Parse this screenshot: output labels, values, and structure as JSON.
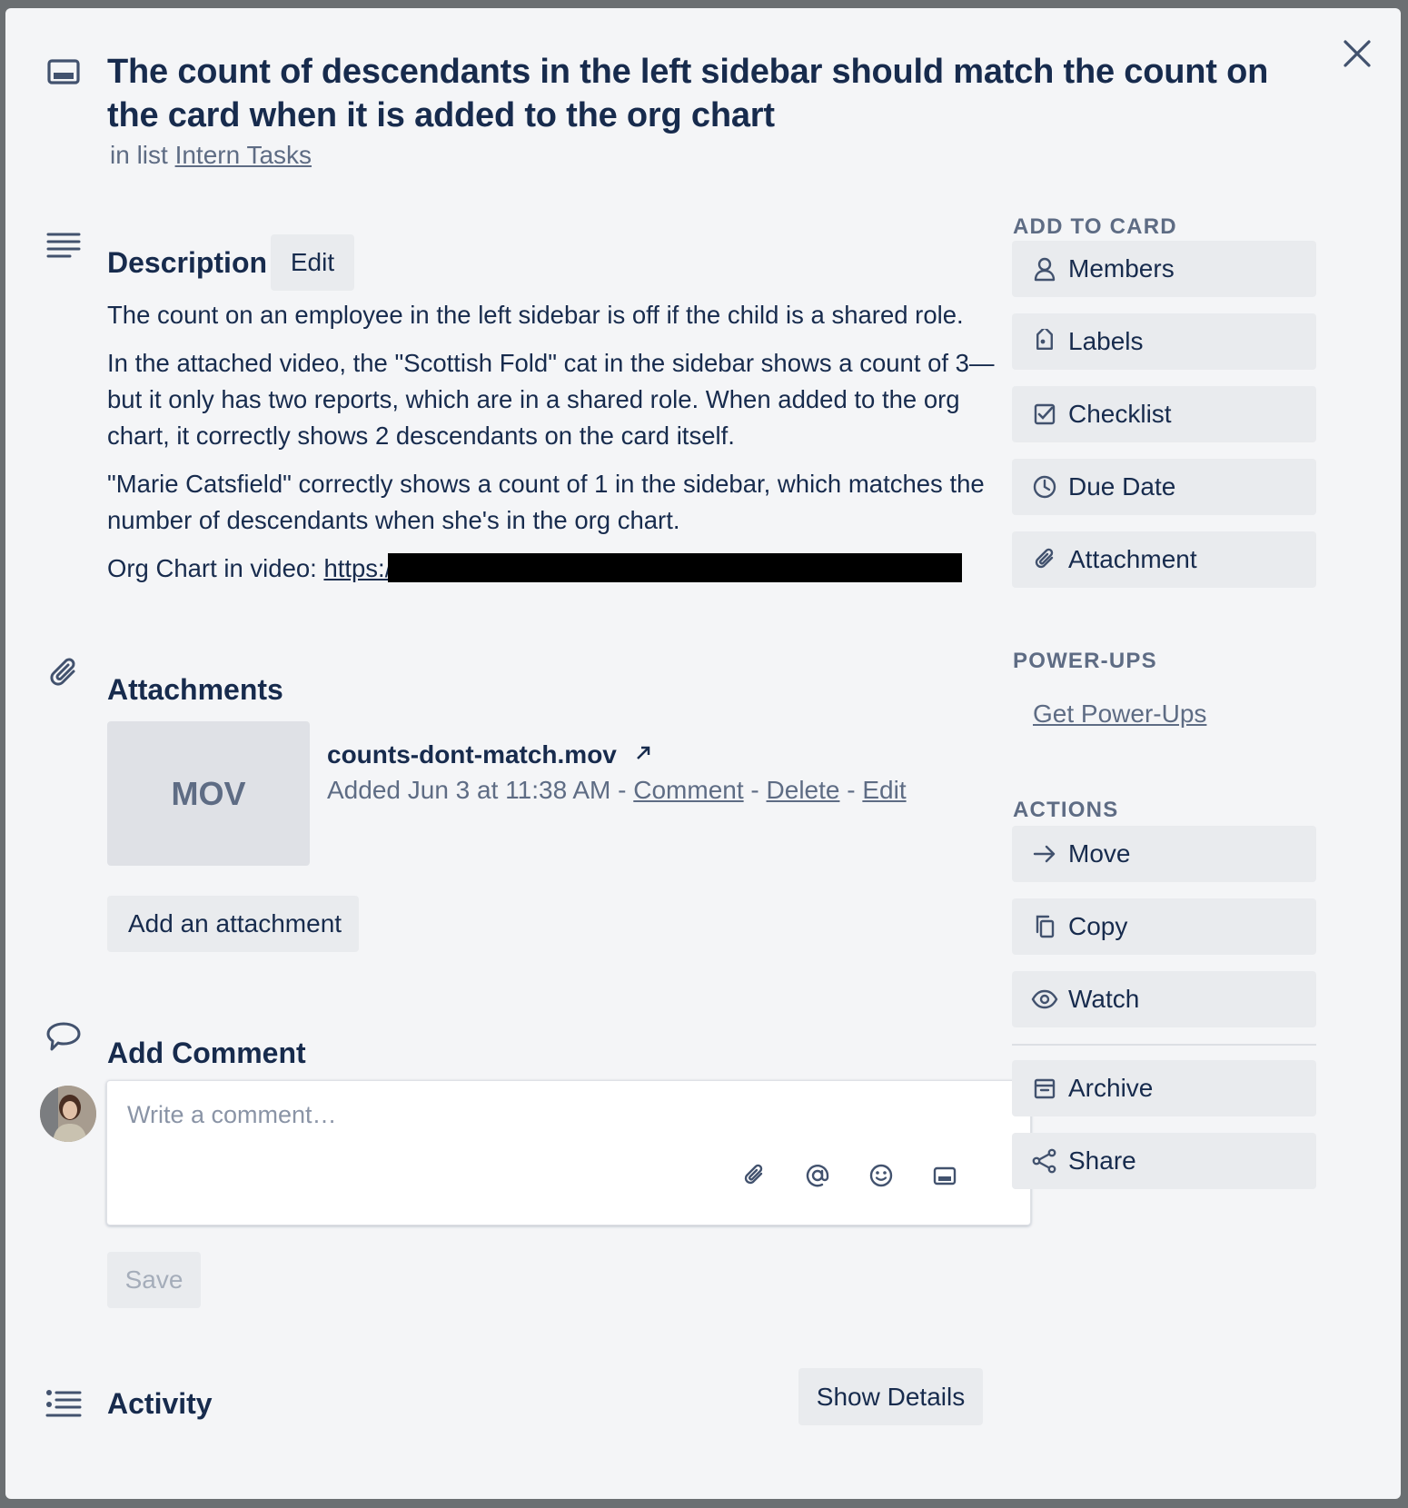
{
  "card": {
    "title": "The count of descendants in the left sidebar should match the count on the card when it is added to the org chart",
    "in_list_prefix": "in list",
    "list_name": "Intern Tasks"
  },
  "description": {
    "heading": "Description",
    "edit_label": "Edit",
    "paragraphs": [
      "The count on an employee in the left sidebar is off if the child is a shared role.",
      "In the attached video, the \"Scottish Fold\" cat in the sidebar shows a count of 3—but it only has two reports, which are in a shared role. When added to the org chart, it correctly shows 2 descendants on the card itself.",
      "\"Marie Catsfield\" correctly shows a count of 1 in the sidebar, which matches the number of descendants when she's in the org chart."
    ],
    "link_prefix": "Org Chart in video:",
    "link_text": "https://"
  },
  "attachments": {
    "heading": "Attachments",
    "items": [
      {
        "thumb_label": "MOV",
        "name": "counts-dont-match.mov",
        "added": "Added Jun 3 at 11:38 AM",
        "sep": "-",
        "comment": "Comment",
        "delete": "Delete",
        "edit": "Edit"
      }
    ],
    "add_label": "Add an attachment"
  },
  "comment": {
    "heading": "Add Comment",
    "placeholder": "Write a comment…",
    "save_label": "Save"
  },
  "activity": {
    "heading": "Activity",
    "show_details_label": "Show Details"
  },
  "sidebar": {
    "add_to_card_heading": "ADD TO CARD",
    "add_to_card": [
      {
        "label": "Members",
        "icon": "person-icon"
      },
      {
        "label": "Labels",
        "icon": "tag-icon"
      },
      {
        "label": "Checklist",
        "icon": "checklist-icon"
      },
      {
        "label": "Due Date",
        "icon": "clock-icon"
      },
      {
        "label": "Attachment",
        "icon": "paperclip-icon"
      }
    ],
    "power_ups_heading": "POWER-UPS",
    "get_power_ups": "Get Power-Ups",
    "actions_heading": "ACTIONS",
    "actions": [
      {
        "label": "Move",
        "icon": "arrow-right-icon"
      },
      {
        "label": "Copy",
        "icon": "copy-icon"
      },
      {
        "label": "Watch",
        "icon": "eye-icon"
      },
      {
        "label": "Archive",
        "icon": "archive-icon"
      },
      {
        "label": "Share",
        "icon": "share-icon"
      }
    ]
  }
}
